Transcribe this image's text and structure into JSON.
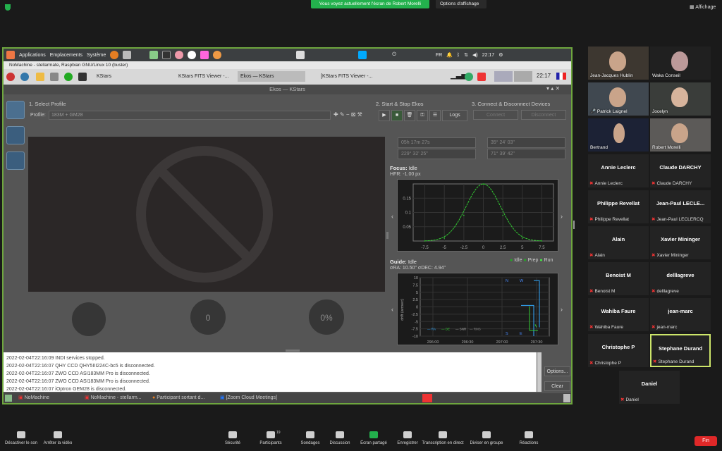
{
  "zoom": {
    "share_banner": "Vous voyez actuellement l'écran de Robert Morelli",
    "share_options": "Options d'affichage",
    "view_label": "Affichage",
    "end_label": "Fin",
    "participants_count": "19",
    "toolbar": [
      {
        "label": "Désactiver le son",
        "icon": "mic-icon"
      },
      {
        "label": "Arrêter la vidéo",
        "icon": "video-icon"
      },
      {
        "label": "Sécurité",
        "icon": "shield-icon"
      },
      {
        "label": "Participants",
        "icon": "participants-icon"
      },
      {
        "label": "Sondages",
        "icon": "poll-icon"
      },
      {
        "label": "Discussion",
        "icon": "chat-icon"
      },
      {
        "label": "Écran partagé",
        "icon": "share-screen-icon"
      },
      {
        "label": "Enregistrer",
        "icon": "record-icon"
      },
      {
        "label": "Transcription en direct",
        "icon": "cc-icon"
      },
      {
        "label": "Diviser en groupe",
        "icon": "breakout-icon"
      },
      {
        "label": "Réactions",
        "icon": "reaction-icon"
      }
    ],
    "video_tiles": [
      "Jean-Jacques Hublin",
      "Waka Conseil",
      "Patrick Laignel",
      "Jocelyn",
      "Bertrand",
      "Robert Morelli"
    ],
    "name_tiles": [
      {
        "name": "Annie Leclerc",
        "sub": "Annie Leclerc"
      },
      {
        "name": "Claude DARCHY",
        "sub": "Claude DARCHY"
      },
      {
        "name": "Philippe Revellat",
        "sub": "Philippe Revellat"
      },
      {
        "name": "Jean-Paul LECLE...",
        "sub": "Jean-Paul LECLERCQ"
      },
      {
        "name": "Alain",
        "sub": "Alain"
      },
      {
        "name": "Xavier Mininger",
        "sub": "Xavier Mininger"
      },
      {
        "name": "Benoist M",
        "sub": "Benoist M"
      },
      {
        "name": "delllagreve",
        "sub": "delllagreve"
      },
      {
        "name": "Wahiba Faure",
        "sub": "Wahiba Faure"
      },
      {
        "name": "jean-marc",
        "sub": "jean-marc"
      },
      {
        "name": "Christophe P",
        "sub": "Christophe P"
      },
      {
        "name": "Stephane Durand",
        "sub": "Stephane Durand"
      },
      {
        "name": "Daniel",
        "sub": "Daniel"
      }
    ]
  },
  "remote": {
    "menu": [
      "Applications",
      "Emplacements",
      "Système"
    ],
    "clock": "22:17",
    "lang": "FR",
    "nomachine_title": "NoMachine - stellarmate, Raspbian GNU/Linux 10 (buster)",
    "tasks": [
      "KStars",
      "KStars FITS Viewer -...",
      "Ekos — KStars",
      "[KStars FITS Viewer -..."
    ],
    "ekos_title": "Ekos — KStars",
    "select_profile": "1. Select Profile",
    "profile_label": "Profile:",
    "profile_value": "183M + GM28",
    "start_stop": "2. Start & Stop Ekos",
    "connect_devices": "3. Connect & Disconnect Devices",
    "logs_btn": "Logs",
    "connect_btn": "Connect",
    "disconnect_btn": "Disconnect",
    "ra": "05h 17m 27s",
    "dec": "35° 24' 03\"",
    "az": "229° 32' 25\"",
    "alt": "71° 39' 42\"",
    "focus_title": "Focus:",
    "focus_state": "Idle",
    "hfr": "HFR: -1.00 px",
    "guide_title": "Guide:",
    "guide_state": "Idle",
    "guide_rms": "σRA: 10.50\" σDEC: 4.94\"",
    "guide_legend": [
      "Idle",
      "Prep",
      "Run"
    ],
    "circle_left": "0",
    "circle_right": "0%",
    "log_lines": [
      "2022-02-04T22:16:09 INDI services stopped.",
      "2022-02-04T22:16:07 QHY CCD QHY5III224C-bc5 is disconnected.",
      "2022-02-04T22:16:07 ZWO CCD ASI183MM Pro is disconnected.",
      "2022-02-04T22:16:07 ZWO CCD ASI183MM Pro is disconnected.",
      "2022-02-04T22:16:07 iOptron GEM28 is disconnected."
    ],
    "options_btn": "Options...",
    "clear_btn": "Clear",
    "bottom_tasks": [
      "NoMachine",
      "NoMachine - stellarm...",
      "Participant sortant d...",
      "[Zoom Cloud Meetings]"
    ]
  },
  "chart_data": [
    {
      "type": "line",
      "title": "",
      "x": [
        -7.5,
        -5,
        -2.5,
        0,
        2.5,
        5,
        7.5
      ],
      "series": [
        {
          "values": [
            0.0,
            0.01,
            0.09,
            0.2,
            0.09,
            0.01,
            0.0
          ]
        }
      ],
      "xlabel": "",
      "ylabel": "",
      "yticks": [
        0.05,
        0.1,
        0.15
      ],
      "xlim": [
        -9,
        9
      ],
      "ylim": [
        0,
        0.2
      ]
    },
    {
      "type": "line",
      "title": "",
      "xlabel": "",
      "ylabel": "drift (arcsec)",
      "xticks": [
        "296:00",
        "296:30",
        "297:00",
        "297:30"
      ],
      "yticks": [
        10,
        7.5,
        5,
        2.5,
        0,
        -2.5,
        -5,
        -7.5,
        -10
      ],
      "ylim": [
        -10,
        10
      ],
      "legend": [
        "RA",
        "DE",
        "SNR",
        "RMS"
      ],
      "annotations": [
        "N",
        "W",
        "S",
        "E"
      ]
    }
  ]
}
